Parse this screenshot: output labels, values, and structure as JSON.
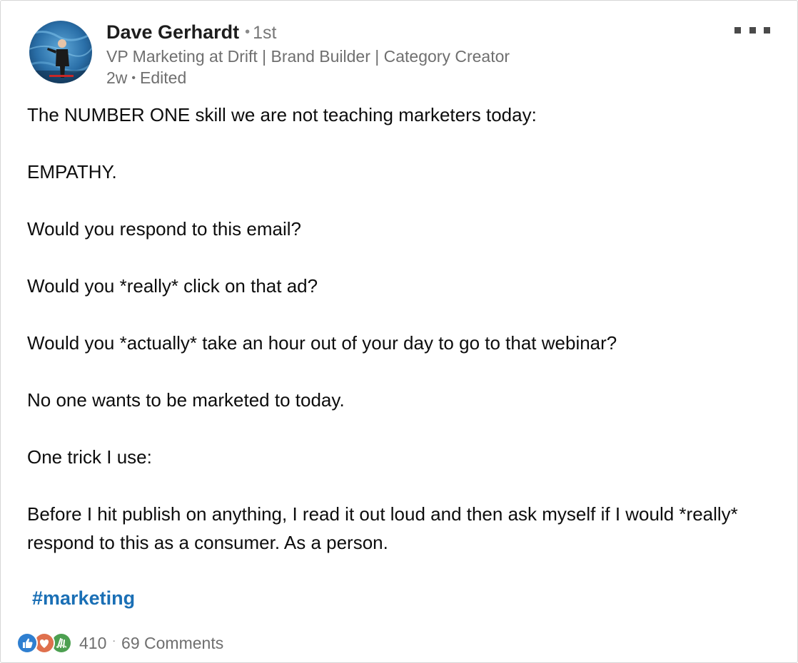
{
  "author": {
    "name": "Dave Gerhardt",
    "degree": "1st",
    "headline": "VP Marketing at Drift | Brand Builder | Category Creator",
    "time": "2w",
    "edited": "Edited"
  },
  "post": {
    "paragraphs": [
      "The NUMBER ONE skill we are not teaching marketers today:",
      "EMPATHY.",
      "Would you respond to this email?",
      "Would you *really* click on that ad?",
      "Would you *actually* take an hour out of your day to go to that webinar?",
      "No one wants to be marketed to today.",
      "One trick I use:",
      "Before I hit publish on anything, I read it out loud and then ask myself if I would *really* respond to this as a consumer. As a person."
    ],
    "hashtag": "#marketing"
  },
  "social": {
    "reactions": [
      "like-icon",
      "love-icon",
      "celebrate-icon"
    ],
    "reaction_count": "410",
    "separator": "·",
    "comments": "69 Comments"
  },
  "colors": {
    "link": "#1a6fb5",
    "secondary_text": "#6f6f6f",
    "like": "#2f7fd0",
    "love": "#df704d",
    "celebrate": "#4c9f50"
  },
  "icons": {
    "more": "more-options-icon",
    "avatar": "avatar-photo"
  }
}
